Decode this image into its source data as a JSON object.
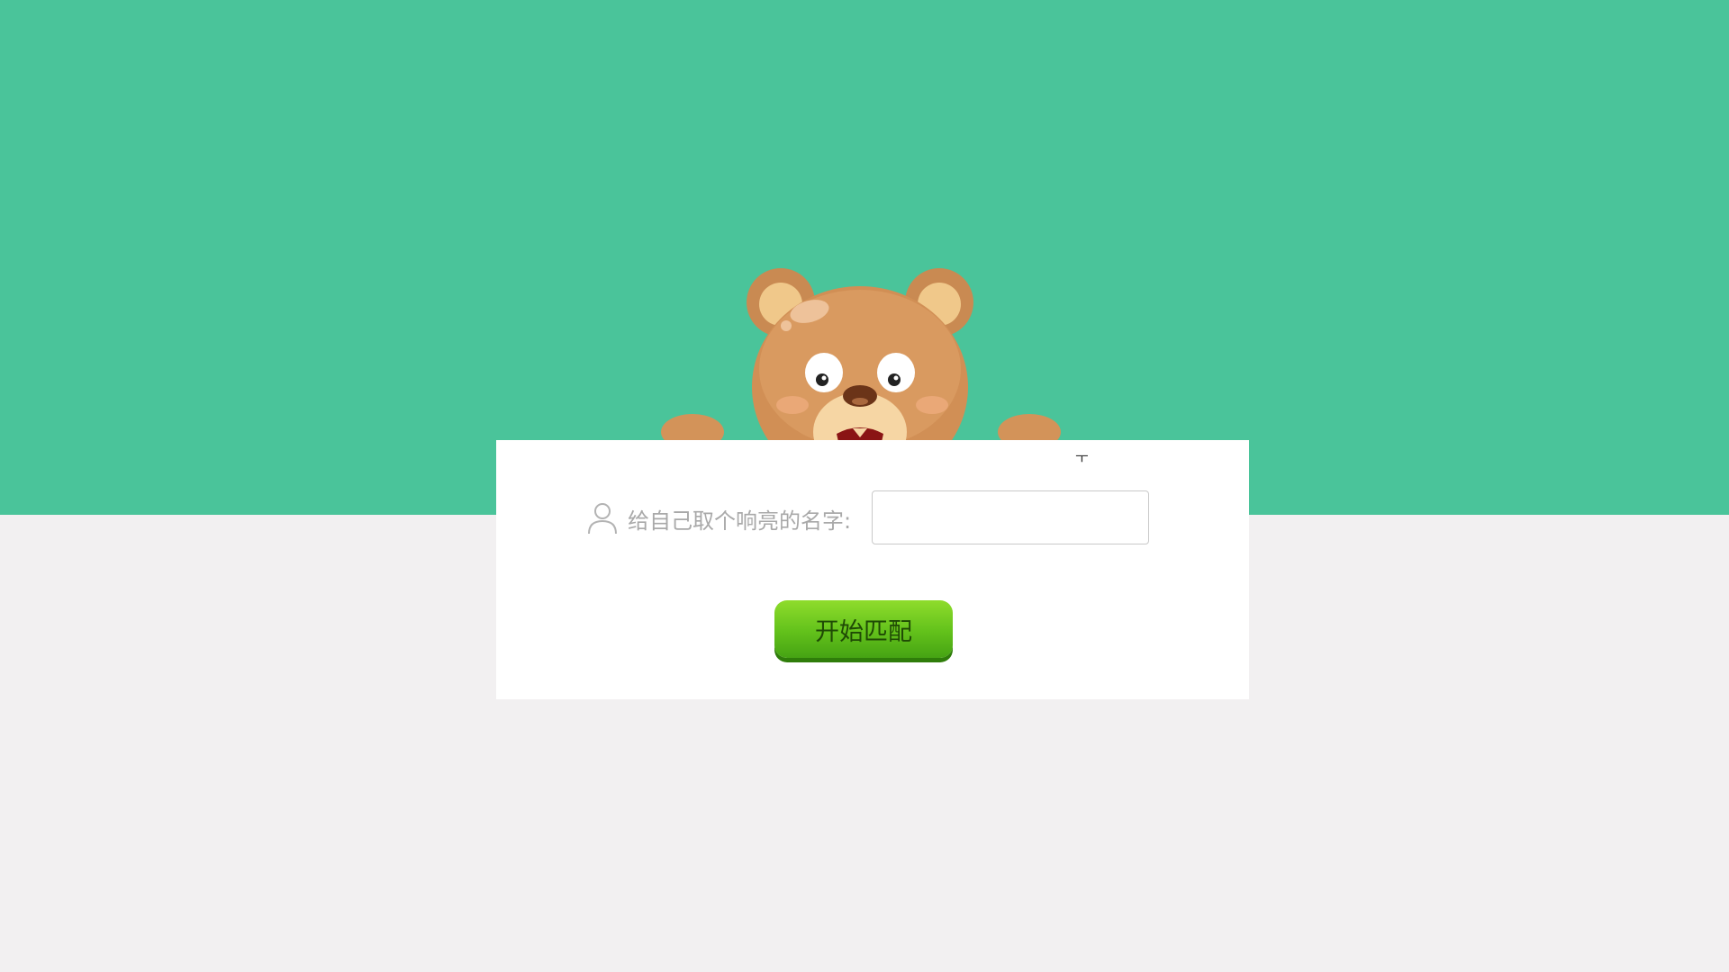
{
  "form": {
    "name_label": "给自己取个响亮的名字:",
    "name_value": "",
    "name_placeholder": "",
    "start_label": "开始匹配",
    "card_mark": "ㅜ"
  },
  "icons": {
    "user": "user-outline-icon",
    "mascot": "bear-mascot"
  },
  "colors": {
    "top_background": "#4ac49a",
    "bottom_background": "#f2f0f1",
    "button_green": "#62c11b",
    "label_gray": "#a9a9a9"
  }
}
